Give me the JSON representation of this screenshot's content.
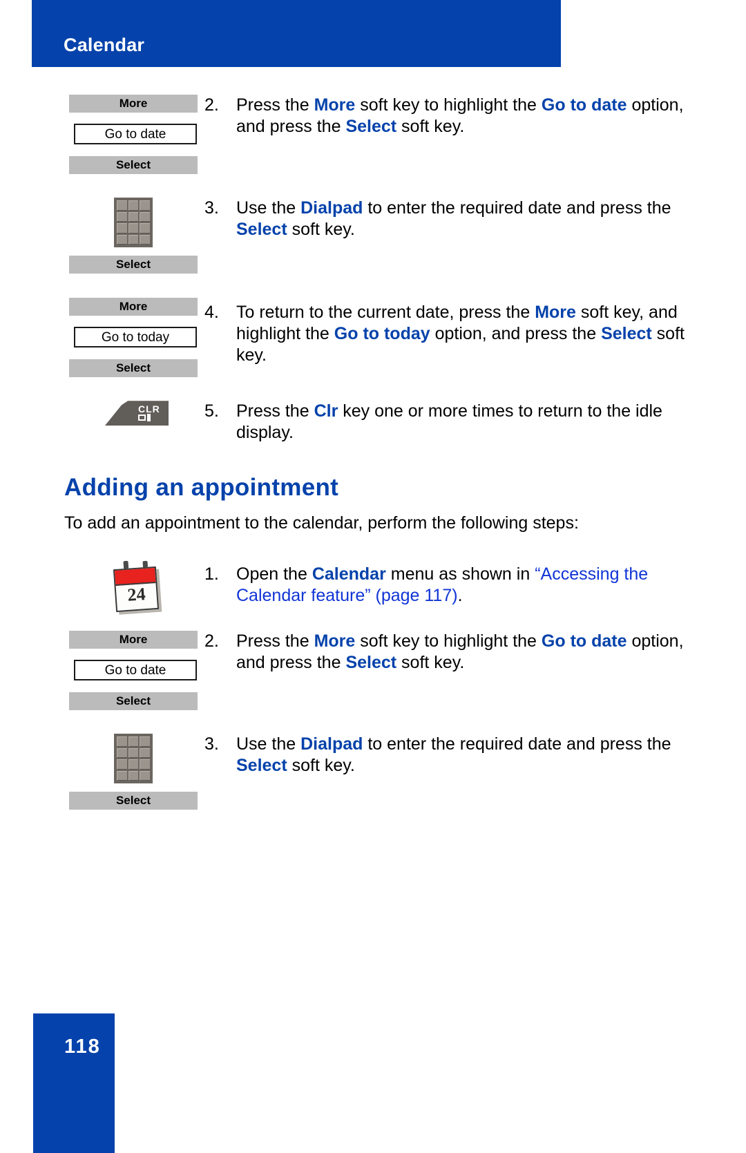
{
  "header": {
    "title": "Calendar",
    "accent_color": "#0542ab"
  },
  "icons": {
    "dialpad": "dialpad-icon",
    "clr_key": "clr-key-icon",
    "calendar": "calendar-icon",
    "clr_label": "CLR"
  },
  "labels": {
    "more": "More",
    "select": "Select",
    "go_to_date": "Go to date",
    "go_to_today": "Go to today",
    "calendar_day": "24"
  },
  "top_steps": [
    {
      "num": "2.",
      "parts": [
        {
          "t": "Press the ",
          "s": "plain"
        },
        {
          "t": "More",
          "s": "key"
        },
        {
          "t": " soft key to highlight the ",
          "s": "plain"
        },
        {
          "t": "Go to date",
          "s": "key"
        },
        {
          "t": " option, and press the ",
          "s": "plain"
        },
        {
          "t": "Select",
          "s": "key"
        },
        {
          "t": " soft key.",
          "s": "plain"
        }
      ]
    },
    {
      "num": "3.",
      "parts": [
        {
          "t": "Use the ",
          "s": "plain"
        },
        {
          "t": "Dialpad",
          "s": "key"
        },
        {
          "t": " to enter the required date and press the ",
          "s": "plain"
        },
        {
          "t": "Select",
          "s": "key"
        },
        {
          "t": " soft key.",
          "s": "plain"
        }
      ]
    },
    {
      "num": "4.",
      "parts": [
        {
          "t": "To return to the current date, press the ",
          "s": "plain"
        },
        {
          "t": "More",
          "s": "key"
        },
        {
          "t": " soft key, and highlight the ",
          "s": "plain"
        },
        {
          "t": "Go to today",
          "s": "key"
        },
        {
          "t": " option, and press the ",
          "s": "plain"
        },
        {
          "t": "Select",
          "s": "key"
        },
        {
          "t": " soft key.",
          "s": "plain"
        }
      ]
    },
    {
      "num": "5.",
      "parts": [
        {
          "t": "Press the ",
          "s": "plain"
        },
        {
          "t": "Clr",
          "s": "key"
        },
        {
          "t": " key one or more times to return to the idle display.",
          "s": "plain"
        }
      ]
    }
  ],
  "section": {
    "heading": "Adding an appointment",
    "intro": "To add an appointment to the calendar, perform the following steps:"
  },
  "bottom_steps": [
    {
      "num": "1.",
      "parts": [
        {
          "t": "Open the ",
          "s": "plain"
        },
        {
          "t": "Calendar",
          "s": "key"
        },
        {
          "t": " menu as shown in ",
          "s": "plain"
        },
        {
          "t": "“Accessing the Calendar feature” (page 117)",
          "s": "xref"
        },
        {
          "t": ".",
          "s": "plain"
        }
      ]
    },
    {
      "num": "2.",
      "parts": [
        {
          "t": "Press the ",
          "s": "plain"
        },
        {
          "t": "More",
          "s": "key"
        },
        {
          "t": " soft key to highlight the ",
          "s": "plain"
        },
        {
          "t": "Go to date",
          "s": "key"
        },
        {
          "t": " option, and press the ",
          "s": "plain"
        },
        {
          "t": "Select",
          "s": "key"
        },
        {
          "t": " soft key.",
          "s": "plain"
        }
      ]
    },
    {
      "num": "3.",
      "parts": [
        {
          "t": "Use the ",
          "s": "plain"
        },
        {
          "t": "Dialpad",
          "s": "key"
        },
        {
          "t": " to enter the required date and press the ",
          "s": "plain"
        },
        {
          "t": "Select",
          "s": "key"
        },
        {
          "t": " soft key.",
          "s": "plain"
        }
      ]
    }
  ],
  "footer": {
    "page_number": "118"
  }
}
